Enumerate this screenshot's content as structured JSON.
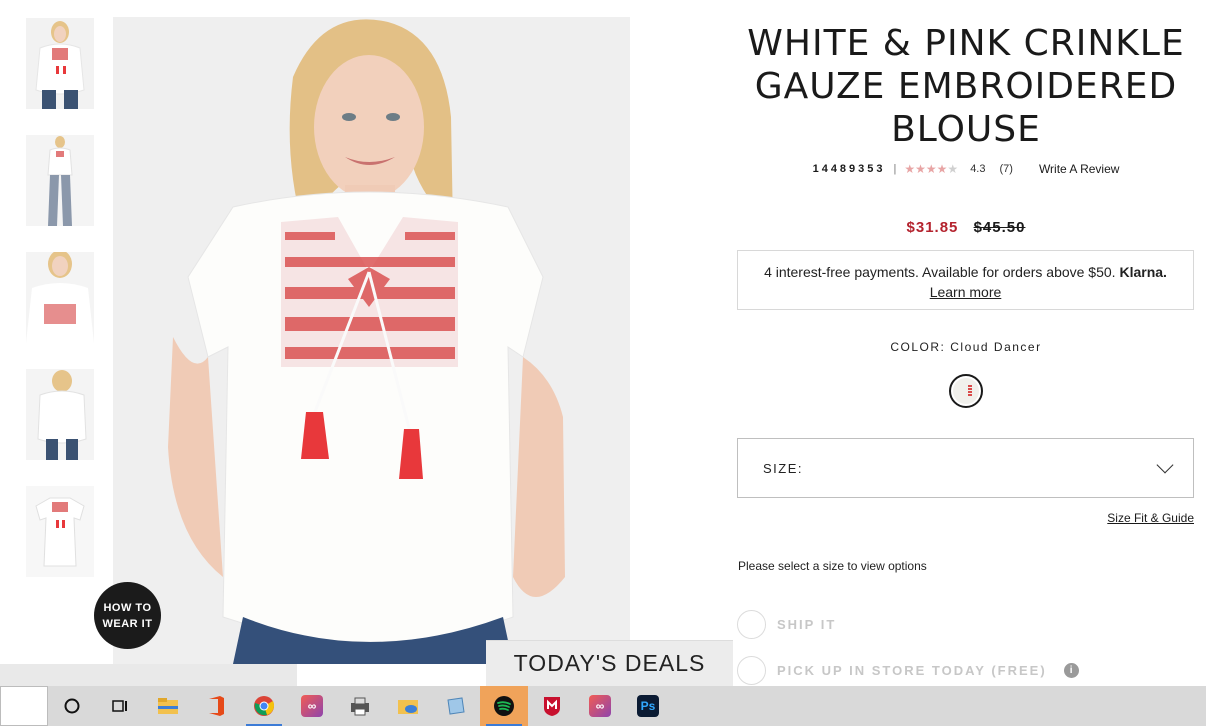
{
  "product": {
    "title": "WHITE & PINK CRINKLE GAUZE EMBROIDERED BLOUSE",
    "sku": "14489353",
    "rating": "4.3",
    "stars": 4.3,
    "review_count": "(7)",
    "write_review": "Write A Review",
    "price_sale": "$31.85",
    "price_original": "$45.50"
  },
  "klarna": {
    "text": "4 interest-free payments. Available for orders above $50.",
    "brand": "Klarna.",
    "learn_more": "Learn more"
  },
  "color": {
    "label": "COLOR:",
    "value": "Cloud Dancer"
  },
  "size": {
    "label": "SIZE:",
    "fit_guide": "Size Fit & Guide",
    "select_message": "Please select a size to view options"
  },
  "fulfillment": {
    "ship": "SHIP IT",
    "pickup": "PICK UP IN STORE TODAY (FREE)",
    "info_icon": "i"
  },
  "gallery": {
    "how_to_line1": "HOW TO",
    "how_to_line2": "WEAR IT",
    "thumbnails": [
      "front",
      "full-length",
      "detail",
      "back",
      "flat"
    ]
  },
  "deals": {
    "label": "TODAY'S DEALS"
  },
  "taskbar": {
    "icons": [
      "cortana-icon",
      "task-view-icon",
      "file-explorer-icon",
      "office-icon",
      "chrome-icon",
      "creative-cloud-icon",
      "printer-icon",
      "file-share-icon",
      "notes-icon",
      "spotify-icon",
      "mcafee-icon",
      "creative-cloud-icon-2",
      "photoshop-icon"
    ],
    "ps_label": "Ps"
  },
  "colors": {
    "sale": "#b4232e",
    "embroidery": "#d94a4a",
    "tassel": "#e8383b",
    "taskbar": "#d9d9d9"
  }
}
